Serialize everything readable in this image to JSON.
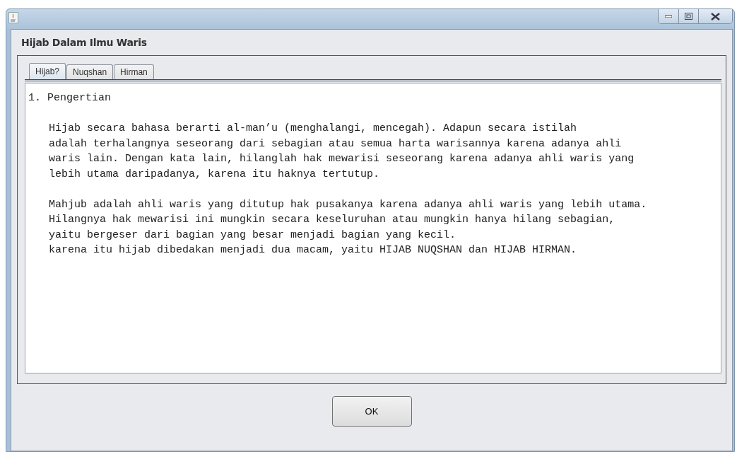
{
  "dialog": {
    "heading": "Hijab Dalam Ilmu Waris"
  },
  "tabs": [
    {
      "label": "Hijab?",
      "selected": true
    },
    {
      "label": "Nuqshan",
      "selected": false
    },
    {
      "label": "Hirman",
      "selected": false
    }
  ],
  "content": {
    "title": "1. Pengertian",
    "paragraphs": [
      [
        "Hijab secara bahasa berarti al-man’u (menghalangi, mencegah). Adapun secara istilah",
        "adalah terhalangnya seseorang dari sebagian atau semua harta warisannya karena adanya ahli",
        "waris lain. Dengan kata lain, hilanglah hak mewarisi seseorang karena adanya ahli waris yang",
        "lebih utama daripadanya, karena itu haknya tertutup."
      ],
      [
        "Mahjub adalah ahli waris yang ditutup hak pusakanya karena adanya ahli waris yang lebih utama.",
        "Hilangnya hak mewarisi ini mungkin secara keseluruhan atau mungkin hanya hilang sebagian,",
        "yaitu bergeser dari bagian yang besar menjadi bagian yang kecil.",
        "karena itu hijab dibedakan menjadi dua macam, yaitu HIJAB NUQSHAN dan HIJAB HIRMAN."
      ]
    ]
  },
  "buttons": [
    {
      "label": "OK"
    }
  ]
}
